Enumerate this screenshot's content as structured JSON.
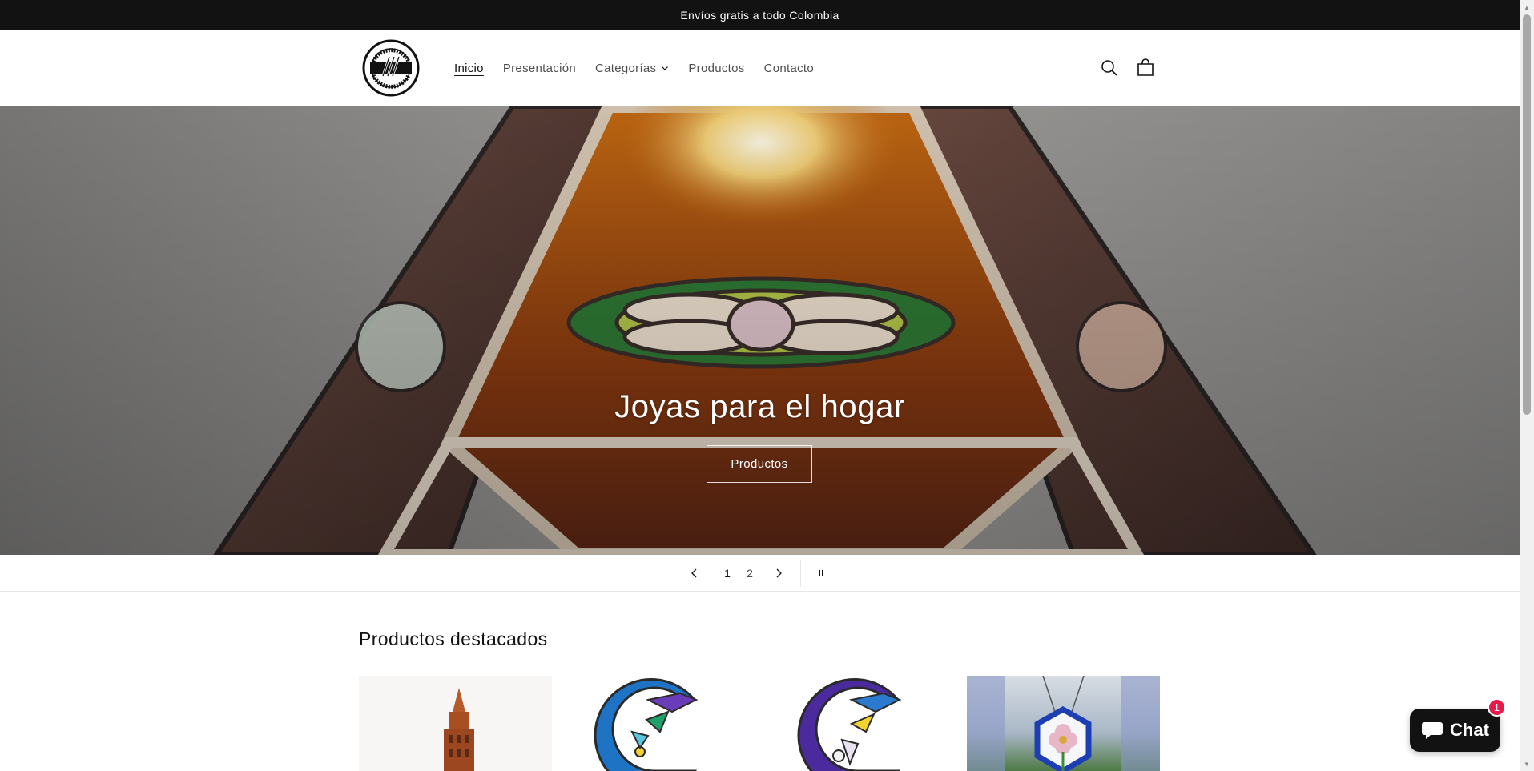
{
  "announcement": {
    "text": "Envíos gratis a todo Colombia"
  },
  "header": {
    "logo_alt": "El Yunque de Cristal",
    "logo_text_top": "EL YUNQUE",
    "logo_text_bottom": "DE CRISTAL",
    "nav": [
      {
        "label": "Inicio",
        "active": true
      },
      {
        "label": "Presentación"
      },
      {
        "label": "Categorías",
        "has_dropdown": true
      },
      {
        "label": "Productos"
      },
      {
        "label": "Contacto"
      }
    ],
    "icons": [
      "search-icon",
      "cart-icon"
    ]
  },
  "hero": {
    "title": "Joyas para el hogar",
    "button_label": "Productos"
  },
  "slider": {
    "prev_icon": "chevron-left-icon",
    "next_icon": "chevron-right-icon",
    "pause_icon": "pause-icon",
    "slides": [
      "1",
      "2"
    ],
    "current": 1
  },
  "featured": {
    "title": "Productos destacados",
    "products": [
      {
        "image": "tower-lamp"
      },
      {
        "image": "moon-blue"
      },
      {
        "image": "moon-purple"
      },
      {
        "image": "hexagon-flower-window"
      }
    ]
  },
  "chat": {
    "label": "Chat",
    "badge": "1"
  },
  "colors": {
    "text": "#121212",
    "announcement_bg": "#121212",
    "chat_bg": "#121212",
    "badge": "#e61948"
  }
}
